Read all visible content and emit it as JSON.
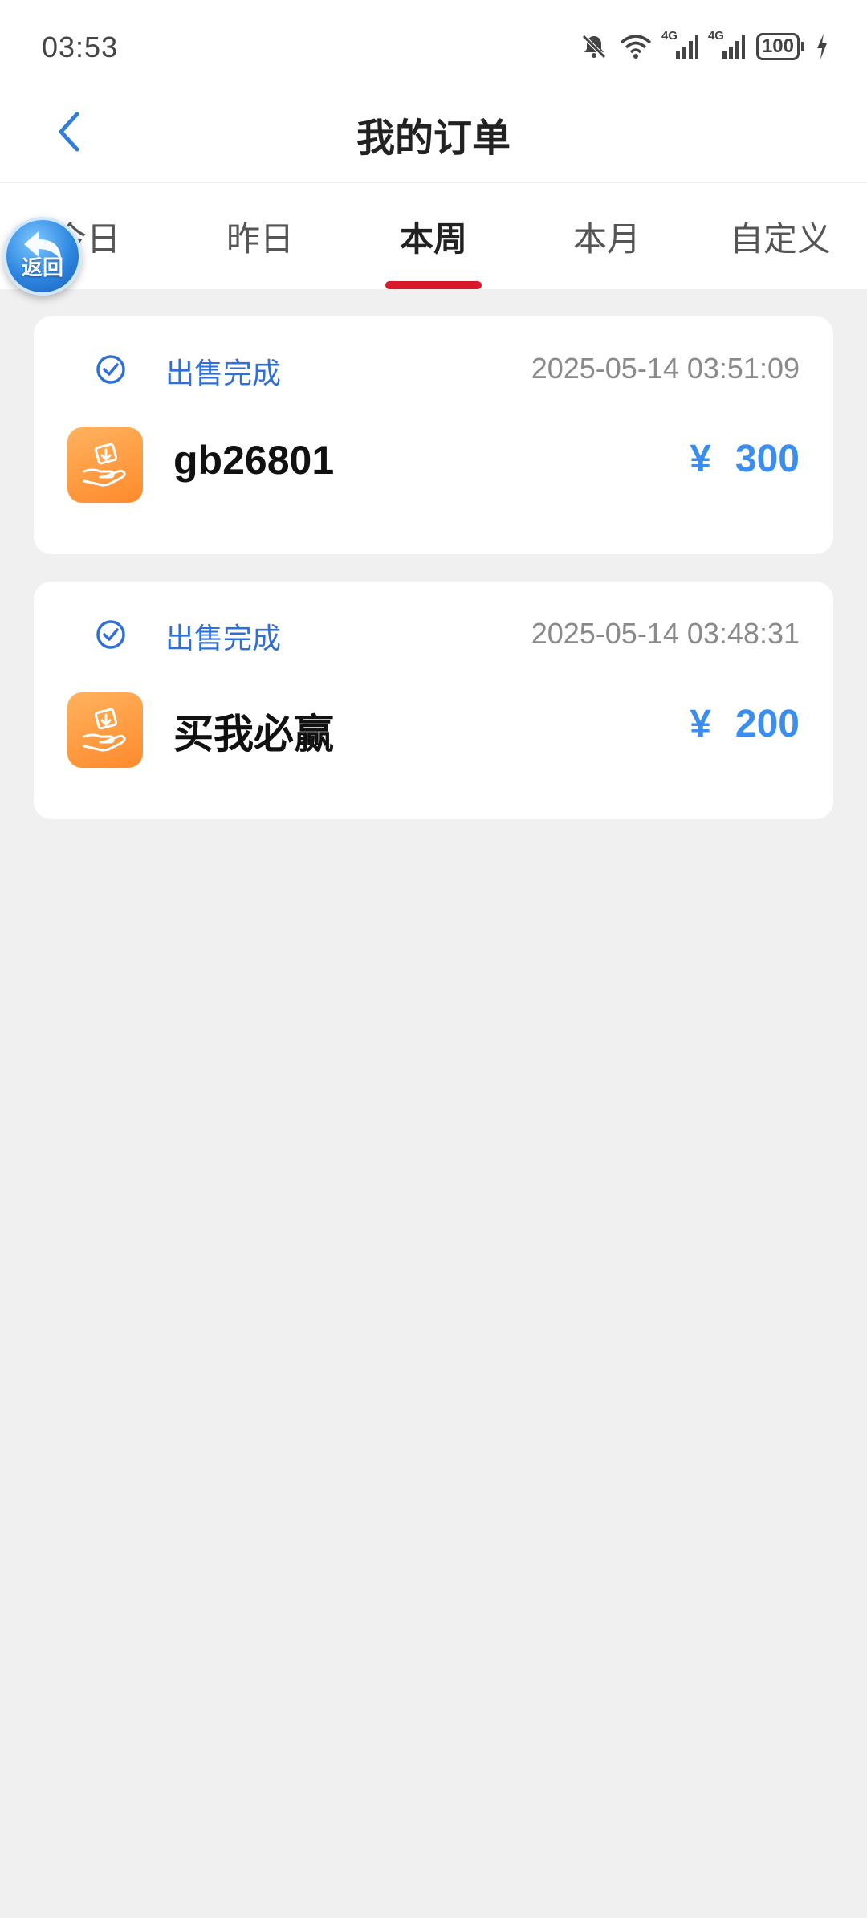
{
  "status_bar": {
    "time": "03:53",
    "icons": [
      "bell-muted-icon",
      "wifi-icon",
      "signal-4g-icon",
      "signal-4g-icon",
      "battery-icon",
      "charging-icon"
    ],
    "net_label_1": "4G",
    "net_label_2": "4G",
    "battery": "100"
  },
  "header": {
    "title": "我的订单",
    "back_icon": "chevron-left-icon"
  },
  "tabs": [
    {
      "label": "今日",
      "active": false
    },
    {
      "label": "昨日",
      "active": false
    },
    {
      "label": "本周",
      "active": true
    },
    {
      "label": "本月",
      "active": false
    },
    {
      "label": "自定义",
      "active": false
    }
  ],
  "float_back": {
    "label": "返回"
  },
  "orders": [
    {
      "status": "出售完成",
      "time": "2025-05-14 03:51:09",
      "name": "gb26801",
      "currency": "¥",
      "amount": "300"
    },
    {
      "status": "出售完成",
      "time": "2025-05-14 03:48:31",
      "name": "买我必赢",
      "currency": "¥",
      "amount": "200"
    }
  ],
  "colors": {
    "accent_blue": "#3b8ef0",
    "status_blue": "#2f6fd6",
    "tab_indicator": "#d9192b",
    "icon_orange": "#ff8a2c",
    "background": "#f0f0f0"
  }
}
